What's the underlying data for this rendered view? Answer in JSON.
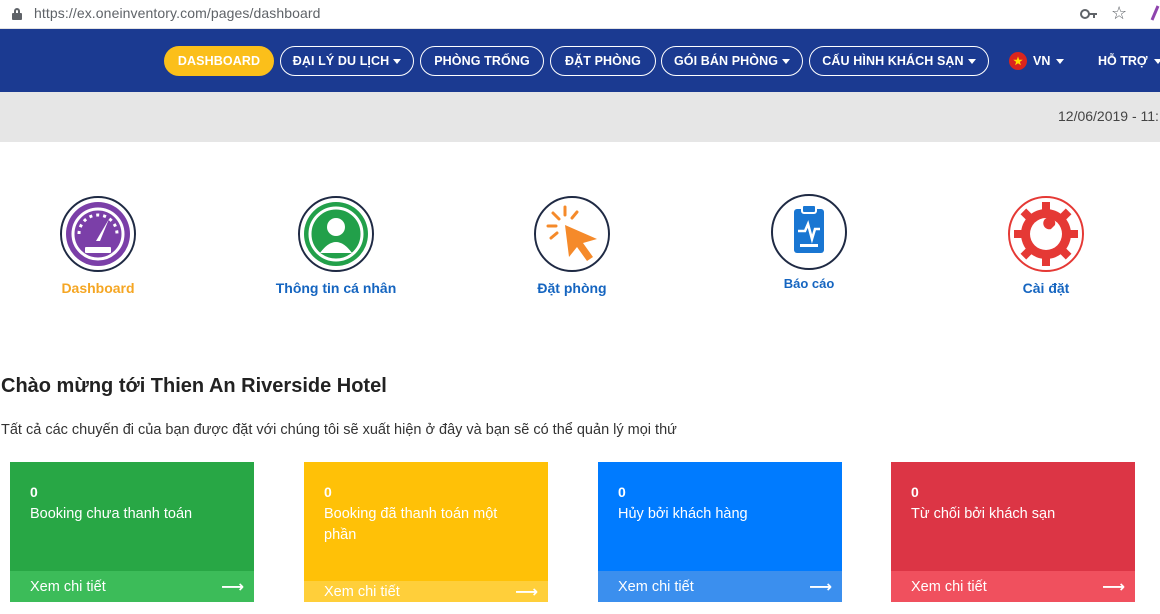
{
  "browser": {
    "url": "https://ex.oneinventory.com/pages/dashboard"
  },
  "nav": {
    "items": [
      {
        "label": "DASHBOARD",
        "dropdown": false,
        "active": true
      },
      {
        "label": "ĐẠI LÝ DU LỊCH",
        "dropdown": true,
        "active": false
      },
      {
        "label": "PHÒNG TRỐNG",
        "dropdown": false,
        "active": false
      },
      {
        "label": "ĐẶT PHÒNG",
        "dropdown": false,
        "active": false
      },
      {
        "label": "GÓI BÁN PHÒNG",
        "dropdown": true,
        "active": false
      },
      {
        "label": "CẤU HÌNH KHÁCH SẠN",
        "dropdown": true,
        "active": false
      }
    ],
    "language": "VN",
    "support": "HỖ TRỢ"
  },
  "date_bar": {
    "datetime": "12/06/2019 - 11:"
  },
  "quick_links": [
    {
      "label": "Dashboard",
      "icon": "speedometer-icon",
      "color": "#f5a623"
    },
    {
      "label": "Thông tin cá nhân",
      "icon": "user-icon",
      "color": "#1565c0"
    },
    {
      "label": "Đặt phòng",
      "icon": "cursor-click-icon",
      "color": "#1565c0"
    },
    {
      "label": "Báo cáo",
      "icon": "clipboard-report-icon",
      "color": "#1565c0"
    },
    {
      "label": "Cài đặt",
      "icon": "gear-wrench-icon",
      "color": "#1565c0"
    }
  ],
  "welcome": {
    "title": "Chào mừng tới Thien An Riverside Hotel",
    "subtitle": "Tất cả các chuyến đi của bạn được đặt với chúng tôi sẽ xuất hiện ở đây và bạn sẽ có thể quản lý mọi thứ"
  },
  "cards": [
    {
      "count": "0",
      "label": "Booking chưa thanh toán",
      "link": "Xem chi tiết",
      "color": "#28a745",
      "footer_color": "#3cbc59"
    },
    {
      "count": "0",
      "label": "Booking đã thanh toán một phần",
      "link": "Xem chi tiết",
      "color": "#ffc107",
      "footer_color": "#ffcf3a"
    },
    {
      "count": "0",
      "label": "Hủy bởi khách hàng",
      "link": "Xem chi tiết",
      "color": "#007bff",
      "footer_color": "#3b8fee"
    },
    {
      "count": "0",
      "label": "Từ chối bởi khách sạn",
      "link": "Xem chi tiết",
      "color": "#dc3545",
      "footer_color": "#f0505e"
    }
  ]
}
